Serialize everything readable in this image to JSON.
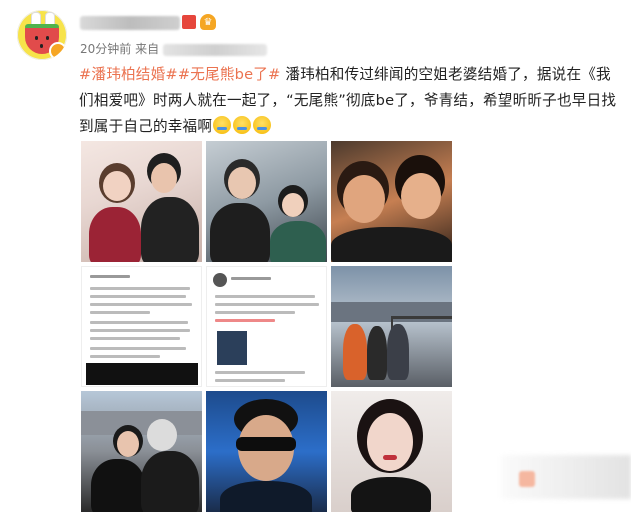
{
  "post": {
    "time_label": "20分钟前",
    "source_prefix": "来自",
    "text_tag1": "#潘玮柏结婚#",
    "text_tag2": "#无尾熊be了#",
    "text_body": " 潘玮柏和传过绯闻的空姐老婆结婚了，据说在《我们相爱吧》时两人就在一起了，“无尾熊”彻底be了，爷青结，希望昕昕子也早日找到属于自己的幸福啊",
    "emoji_count_note": "",
    "photos": [
      {
        "name": "photo-couple-heart"
      },
      {
        "name": "photo-couple-dining"
      },
      {
        "name": "photo-couple-closeup"
      },
      {
        "name": "photo-announcement-post"
      },
      {
        "name": "photo-screenshot-post"
      },
      {
        "name": "photo-group-lakeside"
      },
      {
        "name": "photo-couple-mountain"
      },
      {
        "name": "photo-man-sunglasses"
      },
      {
        "name": "photo-woman-portrait"
      }
    ]
  },
  "colors": {
    "hashtag": "#eb7350",
    "text": "#222222",
    "meta": "#777777"
  }
}
